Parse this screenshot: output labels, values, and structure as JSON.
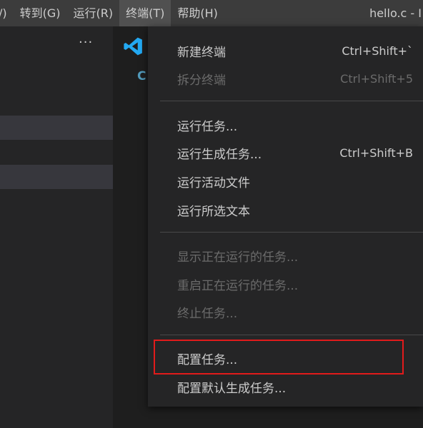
{
  "menubar": {
    "items": [
      {
        "label": "/)"
      },
      {
        "label": "转到(G)"
      },
      {
        "label": "运行(R)"
      },
      {
        "label": "终端(T)"
      },
      {
        "label": "帮助(H)"
      }
    ],
    "window_title": "hello.c - I"
  },
  "sidebar": {
    "more_label": "···"
  },
  "editor": {
    "tab_icon": "vscode-logo-icon",
    "file_icon_text": "C"
  },
  "terminal_menu": {
    "items": [
      {
        "label": "新建终端",
        "shortcut": "Ctrl+Shift+`"
      },
      {
        "label": "拆分终端",
        "shortcut": "Ctrl+Shift+5"
      },
      {
        "label": "运行任务..."
      },
      {
        "label": "运行生成任务...",
        "shortcut": "Ctrl+Shift+B"
      },
      {
        "label": "运行活动文件"
      },
      {
        "label": "运行所选文本"
      },
      {
        "label": "显示正在运行的任务..."
      },
      {
        "label": "重启正在运行的任务..."
      },
      {
        "label": "终止任务..."
      },
      {
        "label": "配置任务..."
      },
      {
        "label": "配置默认生成任务..."
      }
    ]
  },
  "colors": {
    "highlight_box": "#e21b1b",
    "accent_blue": "#23a9f2"
  }
}
